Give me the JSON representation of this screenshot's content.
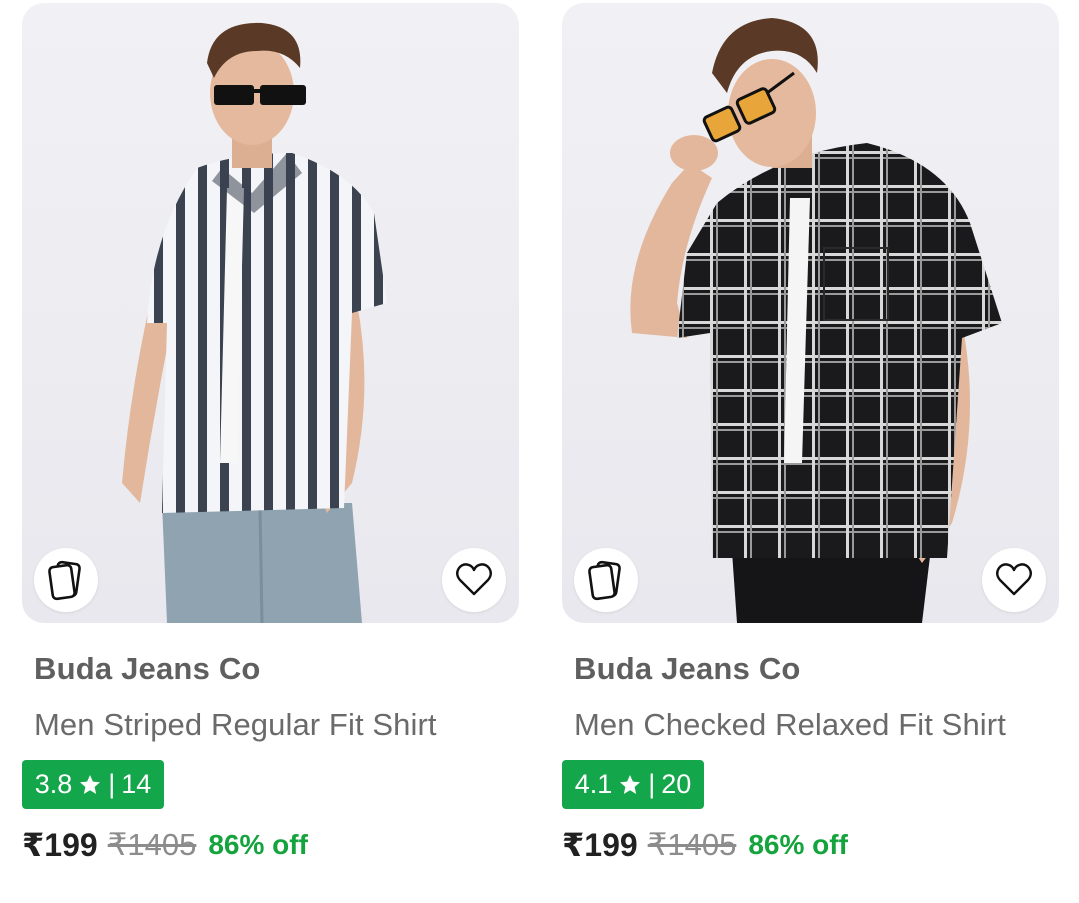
{
  "products": [
    {
      "brand": "Buda Jeans Co",
      "title": "Men Striped Regular Fit Shirt",
      "rating": "3.8",
      "reviews": "14",
      "separator": "|",
      "price": "₹199",
      "mrp": "₹1405",
      "discount": "86% off",
      "image_description": "man in vertical striped short-sleeve shirt and sunglasses",
      "compare_icon": "cards-icon",
      "wishlist_icon": "heart-outline-icon"
    },
    {
      "brand": "Buda Jeans Co",
      "title": "Men Checked Relaxed Fit Shirt",
      "rating": "4.1",
      "reviews": "20",
      "separator": "|",
      "price": "₹199",
      "mrp": "₹1405",
      "discount": "86% off",
      "image_description": "man in black checked short-sleeve shirt adjusting sunglasses",
      "compare_icon": "cards-icon",
      "wishlist_icon": "heart-outline-icon"
    }
  ],
  "colors": {
    "rating_badge": "#14a64a",
    "discount": "#14a33c",
    "price": "#212121",
    "mrp": "#8c8c8c",
    "brand": "#5f5f5f",
    "title": "#6a6a6a"
  }
}
